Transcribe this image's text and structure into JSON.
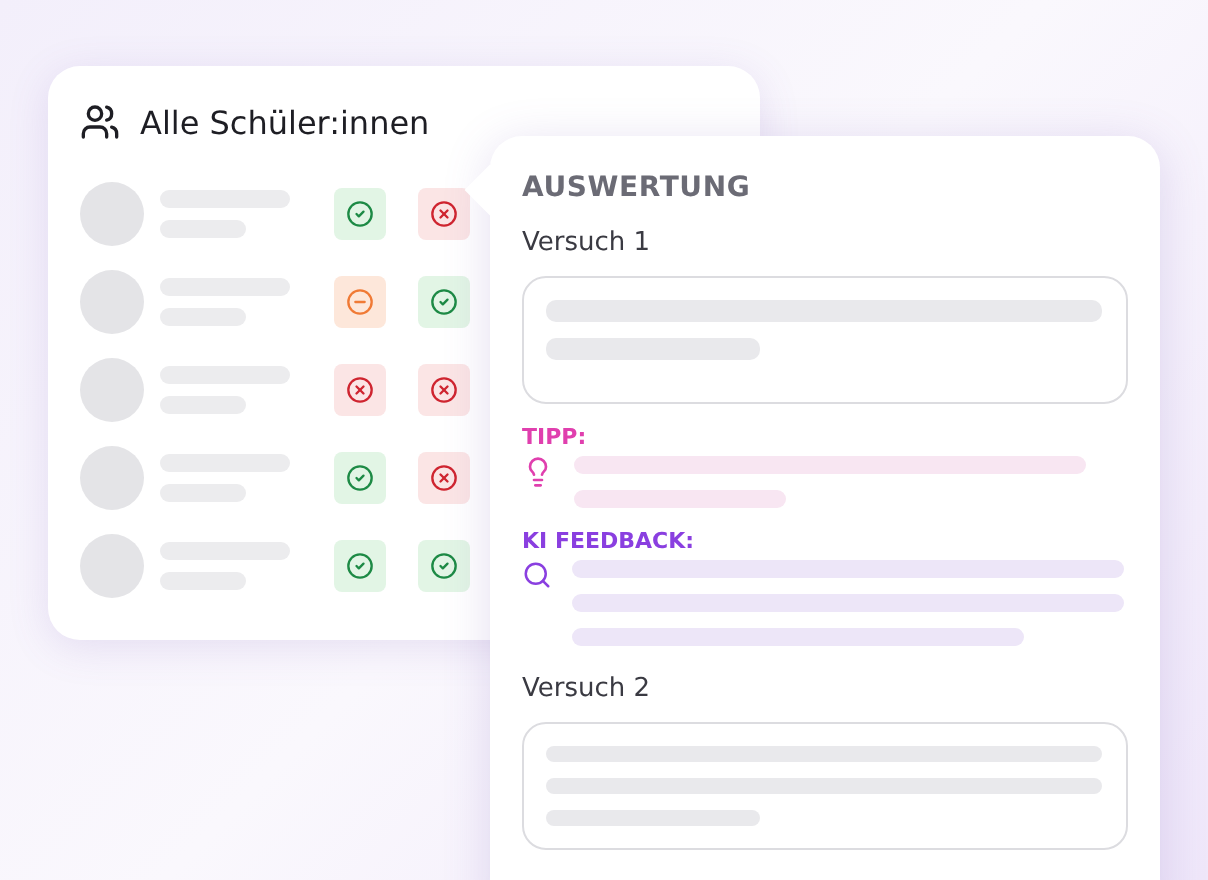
{
  "students_card": {
    "title": "Alle Schüler:innen",
    "rows": [
      {
        "attempts": [
          {
            "kind": "pass"
          },
          {
            "kind": "fail"
          }
        ]
      },
      {
        "attempts": [
          {
            "kind": "partial"
          },
          {
            "kind": "pass"
          }
        ]
      },
      {
        "attempts": [
          {
            "kind": "fail"
          },
          {
            "kind": "fail"
          }
        ]
      },
      {
        "attempts": [
          {
            "kind": "pass"
          },
          {
            "kind": "fail"
          }
        ]
      },
      {
        "attempts": [
          {
            "kind": "pass"
          },
          {
            "kind": "pass"
          }
        ]
      }
    ]
  },
  "evaluation_card": {
    "title": "AUSWERTUNG",
    "attempts": [
      {
        "label": "Versuch 1",
        "tip_label": "TIPP:",
        "feedback_label": "KI FEEDBACK:"
      },
      {
        "label": "Versuch 2"
      }
    ]
  }
}
